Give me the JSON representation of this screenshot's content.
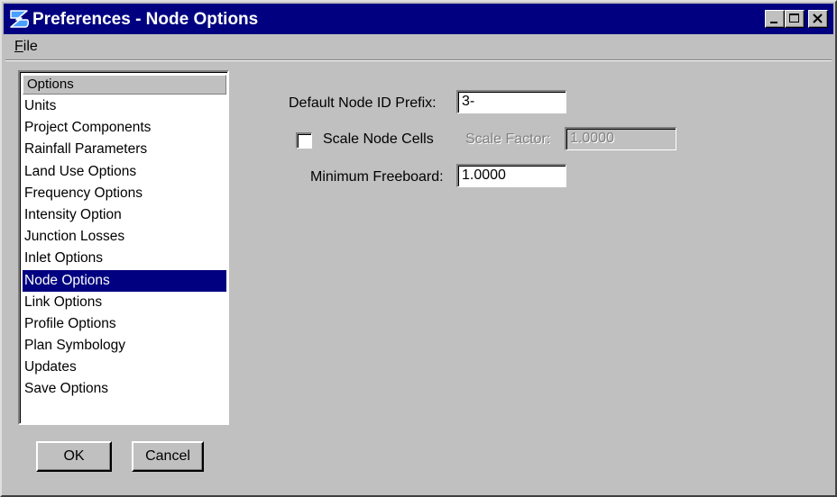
{
  "window": {
    "title": "Preferences - Node Options",
    "icons": {
      "app": "app-logo-icon",
      "minimize": "minimize-icon",
      "maximize": "maximize-icon",
      "close": "close-icon"
    }
  },
  "menu": {
    "file_mnemonic": "F",
    "file_rest": "ile"
  },
  "options_list": {
    "header": "Options",
    "items": [
      "Units",
      "Project Components",
      "Rainfall Parameters",
      "Land Use Options",
      "Frequency Options",
      "Intensity Option",
      "Junction Losses",
      "Inlet Options",
      "Node Options",
      "Link Options",
      "Profile Options",
      "Plan Symbology",
      "Updates",
      "Save Options"
    ],
    "selected": "Node Options"
  },
  "buttons": {
    "ok": "OK",
    "cancel": "Cancel"
  },
  "node_options": {
    "prefix_label": "Default Node ID Prefix:",
    "prefix_value": "3-",
    "scale_cells_label": "Scale Node Cells",
    "scale_cells_checked": false,
    "scale_factor_label": "Scale Factor:",
    "scale_factor_value": "1.0000",
    "freeboard_label": "Minimum Freeboard:",
    "freeboard_value": "1.0000"
  },
  "colors": {
    "titlebar": "#000080",
    "selection": "#000080",
    "face": "#c0c0c0"
  }
}
